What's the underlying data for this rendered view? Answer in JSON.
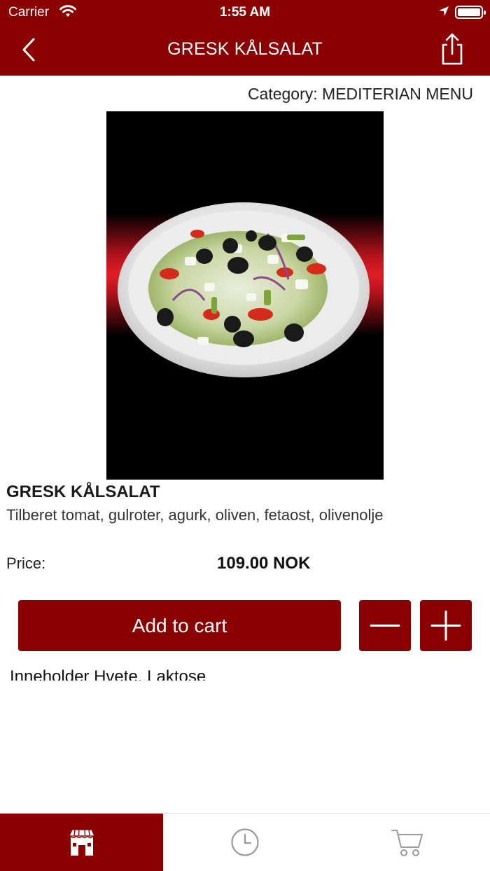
{
  "status_bar": {
    "carrier": "Carrier",
    "time": "1:55 AM"
  },
  "nav": {
    "title": "GRESK KÅLSALAT",
    "back_icon": "chevron-left-icon",
    "share_icon": "share-icon"
  },
  "product": {
    "category": "Category: MEDITERIAN MENU",
    "name": "GRESK KÅLSALAT",
    "description": "Tilberet tomat, gulroter, agurk, oliven, fetaost, olivenolje",
    "price_label": "Price:",
    "price_value": "109.00 NOK",
    "allergens": "Inneholder Hvete, Laktose"
  },
  "actions": {
    "add_to_cart": "Add to cart",
    "minus_icon": "minus-icon",
    "plus_icon": "plus-icon"
  },
  "tabs": [
    {
      "name": "store",
      "icon": "store-icon",
      "active": true
    },
    {
      "name": "history",
      "icon": "clock-icon",
      "active": false
    },
    {
      "name": "cart",
      "icon": "cart-icon",
      "active": false
    }
  ],
  "colors": {
    "brand": "#8b0000",
    "text": "#1a1a1a",
    "tab_inactive": "#9a9a9a"
  }
}
